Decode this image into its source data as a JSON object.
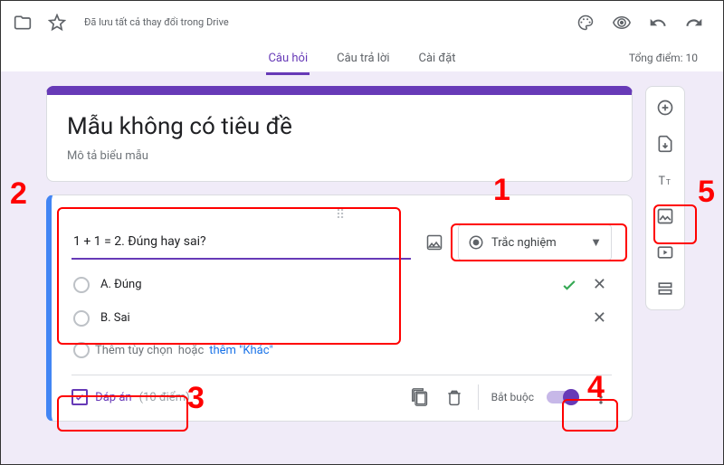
{
  "header": {
    "save_status": "Đã lưu tất cả thay đổi trong Drive",
    "tabs": {
      "questions": "Câu hỏi",
      "responses": "Câu trả lời",
      "settings": "Cài đặt"
    },
    "total_points": "Tổng điểm: 10"
  },
  "form": {
    "title": "Mẫu không có tiêu đề",
    "description": "Mô tả biểu mẫu"
  },
  "question": {
    "text": "1 + 1 = 2. Đúng hay sai?",
    "type_label": "Trắc nghiệm",
    "options": [
      {
        "label": "A. Đúng",
        "correct": true
      },
      {
        "label": "B. Sai",
        "correct": false
      }
    ],
    "add_option": "Thêm tùy chọn",
    "or": "hoặc",
    "add_other": "thêm \"Khác\"",
    "answer_key": "Đáp án",
    "points": "(10 điểm)",
    "required": "Bắt buộc"
  },
  "annotations": {
    "n1": "1",
    "n2": "2",
    "n3": "3",
    "n4": "4",
    "n5": "5"
  }
}
